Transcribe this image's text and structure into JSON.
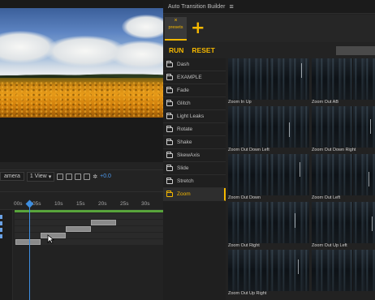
{
  "viewer": {
    "camera_label": "amera",
    "view_label": "1 View",
    "exposure_value": "+0.0"
  },
  "timeline": {
    "ticks": [
      "00s",
      "05s",
      "10s",
      "15s",
      "20s",
      "25s",
      "30s"
    ]
  },
  "panel": {
    "title": "Auto Transition Builder",
    "menu_icon": "hamburger-icon",
    "tab_close": "×",
    "tab_label": "presets",
    "add_tab": "+",
    "run_label": "RUN",
    "reset_label": "RESET",
    "accent_color": "#f5b800",
    "folders": [
      {
        "label": "Dash"
      },
      {
        "label": "EXAMPLE"
      },
      {
        "label": "Fade"
      },
      {
        "label": "Glitch"
      },
      {
        "label": "Light Leaks"
      },
      {
        "label": "Rotate"
      },
      {
        "label": "Shake"
      },
      {
        "label": "SkewAxis"
      },
      {
        "label": "Slide"
      },
      {
        "label": "Stretch"
      },
      {
        "label": "Zoom",
        "active": true
      }
    ],
    "presets": [
      {
        "caption": "Zoom In Up"
      },
      {
        "caption": "Zoom Out AB"
      },
      {
        "caption": "Zoom Out Down Left"
      },
      {
        "caption": "Zoom Out Down Right"
      },
      {
        "caption": "Zoom Out Down"
      },
      {
        "caption": "Zoom Out Left"
      },
      {
        "caption": "Zoom Out Right"
      },
      {
        "caption": "Zoom Out Up Left"
      },
      {
        "caption": "Zoom Out Up Right"
      },
      {
        "caption": ""
      }
    ]
  }
}
